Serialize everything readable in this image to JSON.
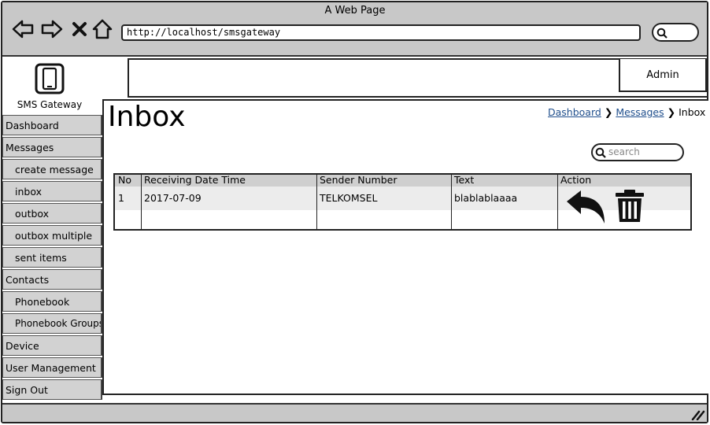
{
  "window": {
    "title": "A Web Page"
  },
  "browser": {
    "url": "http://localhost/smsgateway"
  },
  "app": {
    "name": "SMS Gateway",
    "user_label": "Admin"
  },
  "sidebar": {
    "items": [
      {
        "label": "Dashboard",
        "level": 0
      },
      {
        "label": "Messages",
        "level": 0
      },
      {
        "label": "create message",
        "level": 1
      },
      {
        "label": "inbox",
        "level": 1
      },
      {
        "label": "outbox",
        "level": 1
      },
      {
        "label": "outbox multiple",
        "level": 1
      },
      {
        "label": "sent items",
        "level": 1
      },
      {
        "label": "Contacts",
        "level": 0
      },
      {
        "label": "Phonebook",
        "level": 1
      },
      {
        "label": "Phonebook Groups",
        "level": 1
      },
      {
        "label": "Device",
        "level": 0
      },
      {
        "label": "User Management",
        "level": 0
      },
      {
        "label": "Sign Out",
        "level": 0
      }
    ]
  },
  "page": {
    "title": "Inbox",
    "breadcrumb": {
      "home": "Dashboard",
      "parent": "Messages",
      "current": "Inbox"
    },
    "search_placeholder": "search"
  },
  "table": {
    "columns": [
      "No",
      "Receiving Date Time",
      "Sender Number",
      "Text",
      "Action"
    ],
    "rows": [
      {
        "no": "1",
        "received": "2017-07-09",
        "sender": "TELKOMSEL",
        "text": "blablablaaaa",
        "actions": [
          "reply-icon",
          "trash-icon"
        ]
      }
    ]
  }
}
